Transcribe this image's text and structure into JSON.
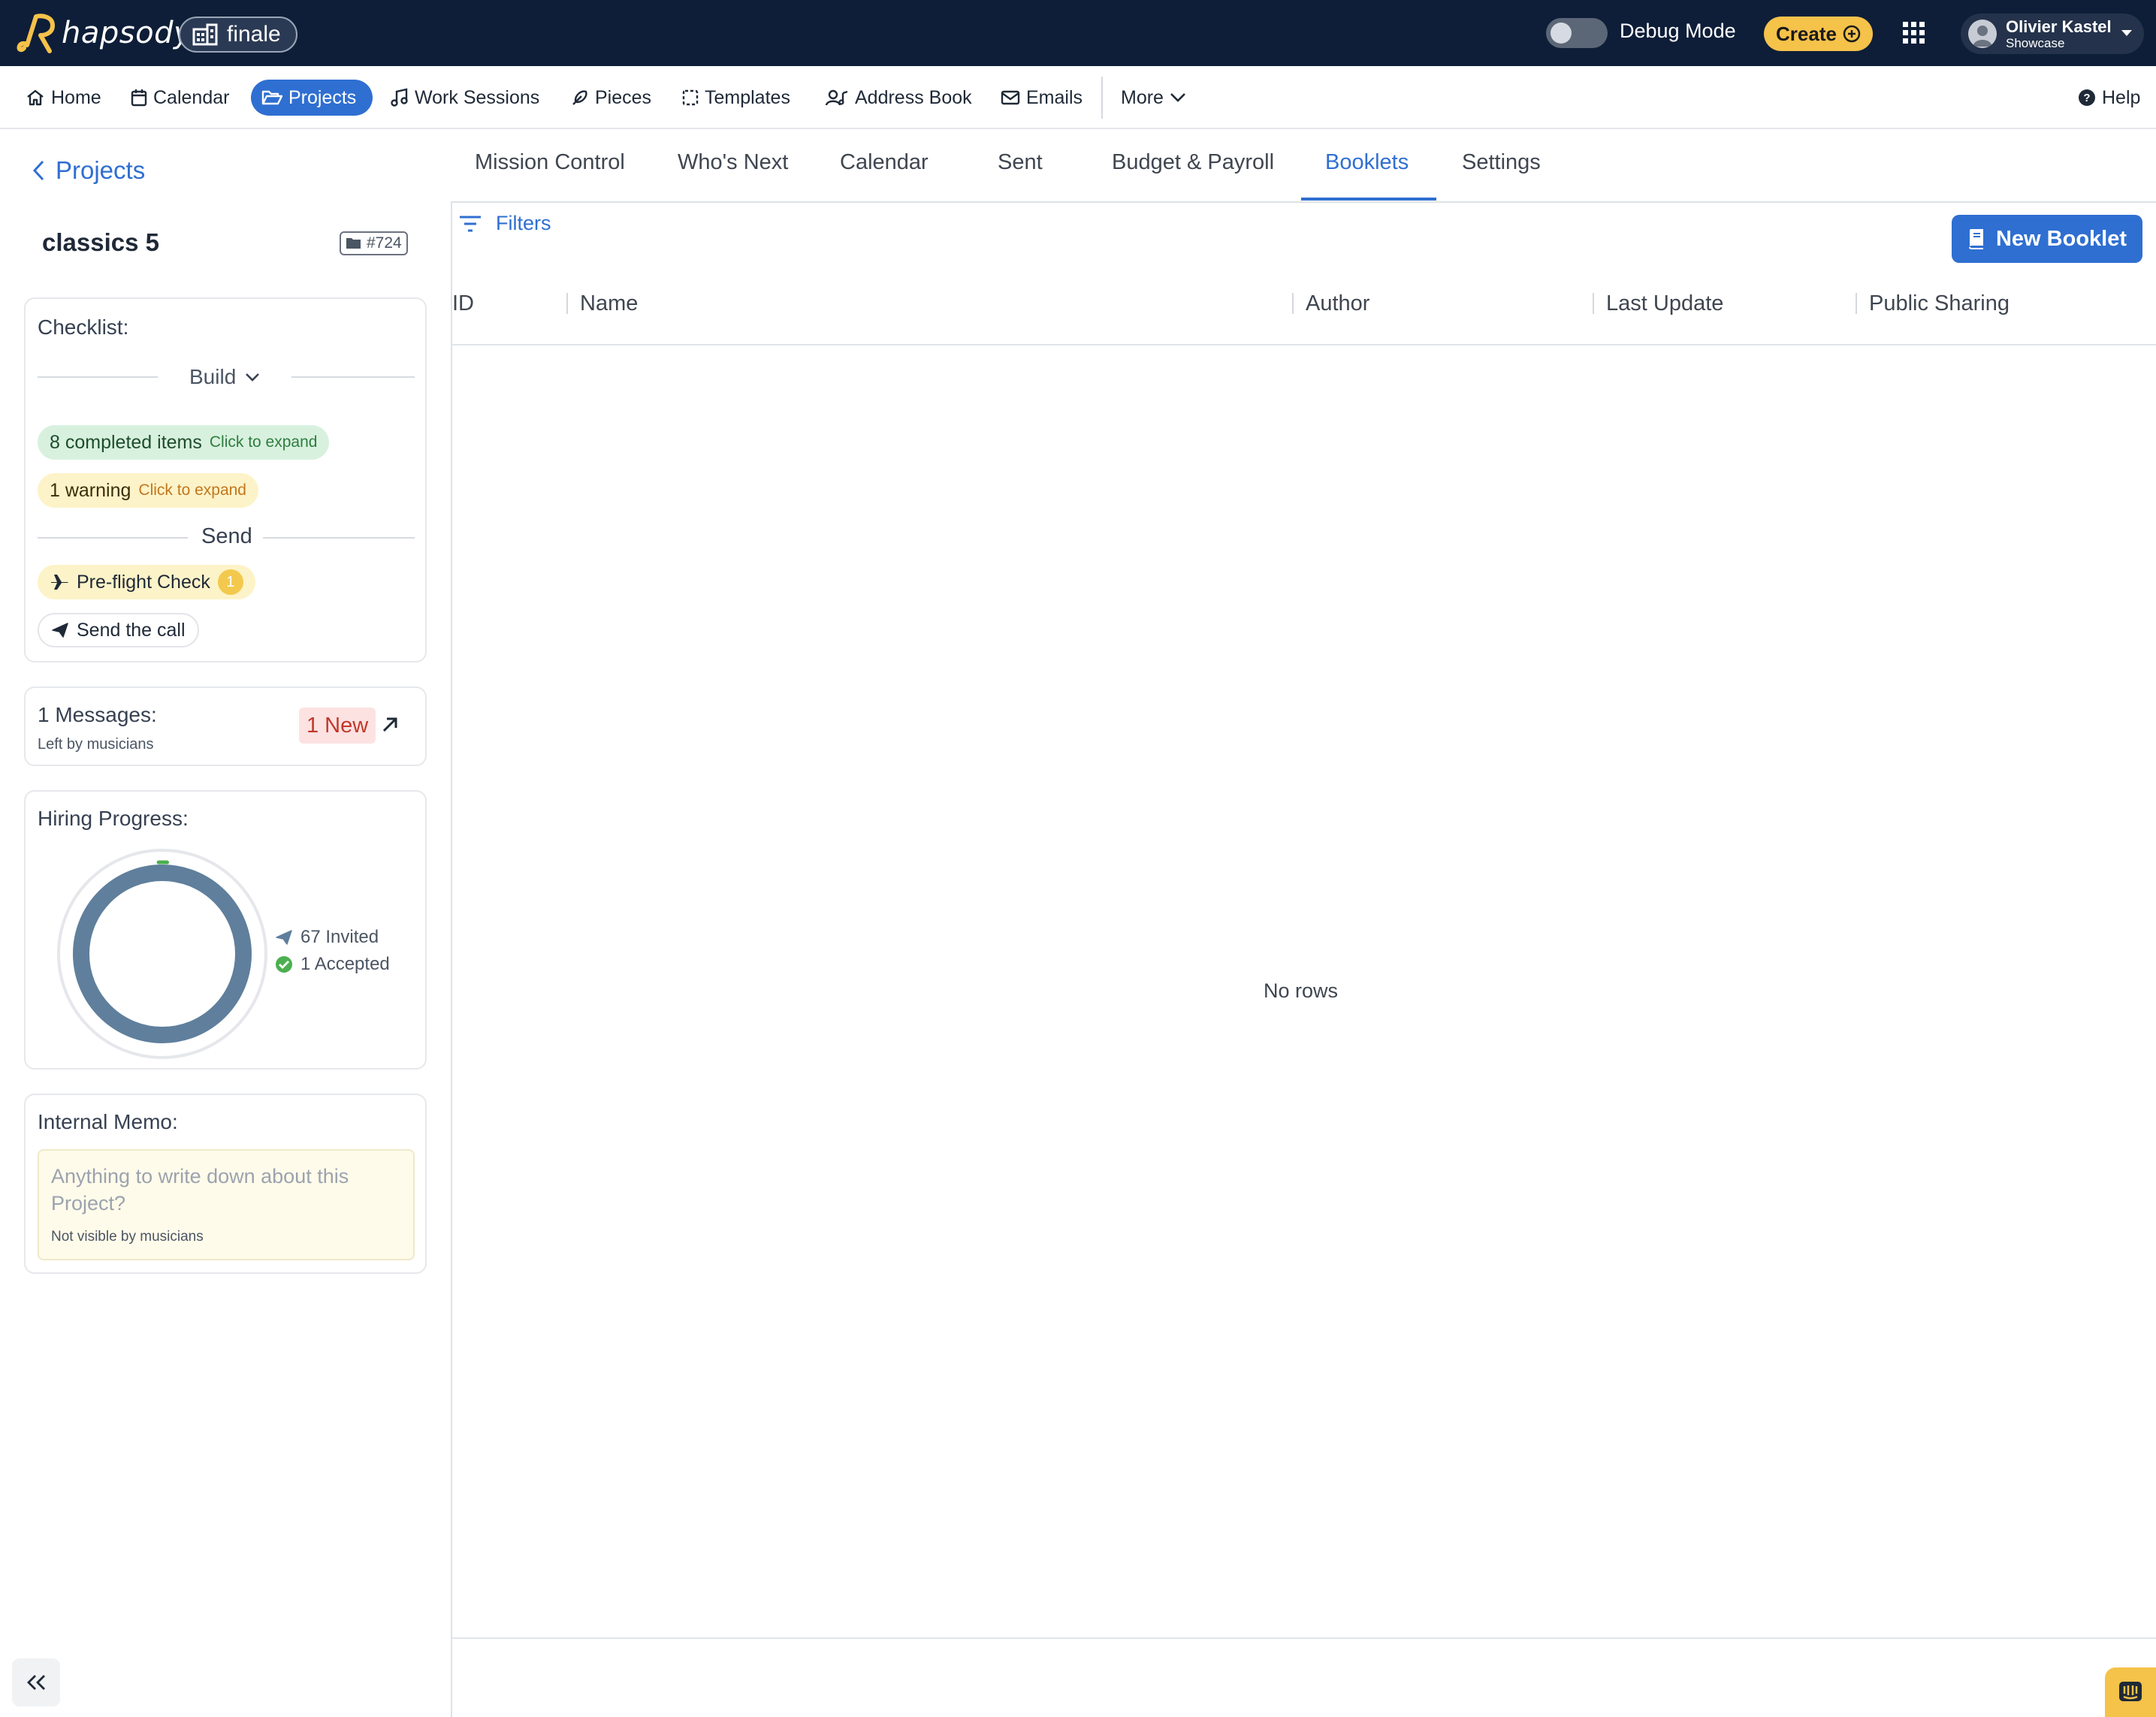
{
  "app": {
    "logo_text": "hapsody",
    "org_name": "finale",
    "debug_label": "Debug Mode",
    "create_label": "Create",
    "user_name": "Olivier Kastel",
    "user_org": "Showcase",
    "colors": {
      "topbar": "#0e1e38",
      "accent": "#2f6fd1",
      "create": "#f5c24a"
    }
  },
  "nav": {
    "items": [
      {
        "label": "Home",
        "icon": "home-icon"
      },
      {
        "label": "Calendar",
        "icon": "calendar-icon"
      },
      {
        "label": "Projects",
        "icon": "folder-open-icon",
        "active": true
      },
      {
        "label": "Work Sessions",
        "icon": "music-note-icon"
      },
      {
        "label": "Pieces",
        "icon": "feather-icon"
      },
      {
        "label": "Templates",
        "icon": "template-icon"
      },
      {
        "label": "Address Book",
        "icon": "address-book-icon"
      },
      {
        "label": "Emails",
        "icon": "envelope-icon"
      }
    ],
    "more_label": "More",
    "help_label": "Help"
  },
  "sidebar": {
    "back_label": "Projects",
    "project_title": "classics 5",
    "project_id": "#724",
    "checklist": {
      "title": "Checklist:",
      "build_label": "Build",
      "completed_label": "8 completed items",
      "completed_hint": "Click to expand",
      "warning_label": "1 warning",
      "warning_hint": "Click to expand",
      "send_label": "Send",
      "preflight_label": "Pre-flight Check",
      "preflight_count": "1",
      "send_call_label": "Send the call"
    },
    "messages": {
      "title": "1 Messages:",
      "subtitle": "Left by musicians",
      "new_badge": "1 New"
    },
    "hiring": {
      "title": "Hiring Progress:",
      "invited_label": "67 Invited",
      "accepted_label": "1 Accepted",
      "invited": 67,
      "accepted": 1
    },
    "memo": {
      "title": "Internal Memo:",
      "placeholder": "Anything to write down about this Project?",
      "note": "Not visible by musicians"
    }
  },
  "main": {
    "tabs": [
      {
        "label": "Mission Control"
      },
      {
        "label": "Who's Next"
      },
      {
        "label": "Calendar"
      },
      {
        "label": "Sent"
      },
      {
        "label": "Budget & Payroll"
      },
      {
        "label": "Booklets",
        "active": true
      },
      {
        "label": "Settings"
      }
    ],
    "filters_label": "Filters",
    "new_booklet_label": "New Booklet",
    "columns": [
      "ID",
      "Name",
      "Author",
      "Last Update",
      "Public Sharing"
    ],
    "empty_label": "No rows"
  }
}
